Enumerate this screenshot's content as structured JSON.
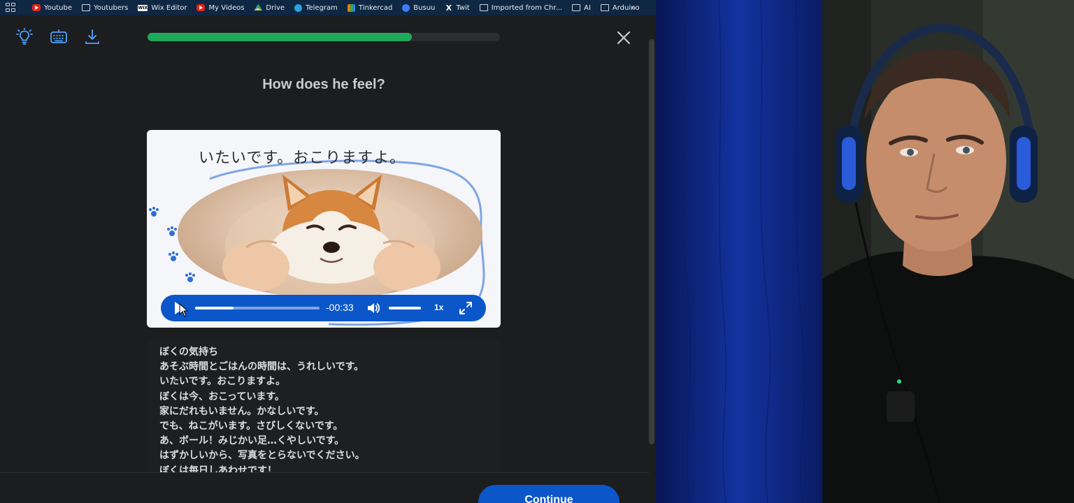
{
  "bookmarks": {
    "items": [
      {
        "label": "Youtube",
        "icon": "youtube-icon"
      },
      {
        "label": "Youtubers",
        "icon": "folder-icon"
      },
      {
        "label": "Wix Editor",
        "icon": "wix-icon"
      },
      {
        "label": "My Videos",
        "icon": "youtube-icon"
      },
      {
        "label": "Drive",
        "icon": "drive-icon"
      },
      {
        "label": "Telegram",
        "icon": "telegram-icon"
      },
      {
        "label": "Tinkercad",
        "icon": "tinkercad-icon"
      },
      {
        "label": "Busuu",
        "icon": "busuu-icon"
      },
      {
        "label": "Twit",
        "icon": "x-icon"
      },
      {
        "label": "Imported from Chr...",
        "icon": "folder-icon"
      },
      {
        "label": "AI",
        "icon": "folder-icon"
      },
      {
        "label": "Arduino",
        "icon": "folder-icon"
      }
    ],
    "more": "»"
  },
  "toolbar": {
    "icons": [
      "lightbulb-icon",
      "keyboard-icon",
      "download-icon"
    ],
    "progress_fraction": 0.75,
    "progress_color": "#1faa59"
  },
  "lesson": {
    "question": "How does he feel?",
    "card_caption": "いたいです。おこりますよ。",
    "player": {
      "time": "-00:33",
      "speed": "1x",
      "seek_fraction": 0.31,
      "accent": "#0b56c9"
    },
    "story_lines": [
      "ぼくの気持ち",
      "あそぶ時間とごはんの時間は、うれしいです。",
      "いたいです。おこりますよ。",
      "ぼくは今、おこっています。",
      "家にだれもいません。かなしいです。",
      "でも、ねこがいます。さびしくないです。",
      "あ、ボール！みじかい足…くやしいです。",
      "はずかしいから、写真をとらないでください。",
      "ぼくは毎日しあわせです！"
    ],
    "continue_label": "Continue"
  }
}
